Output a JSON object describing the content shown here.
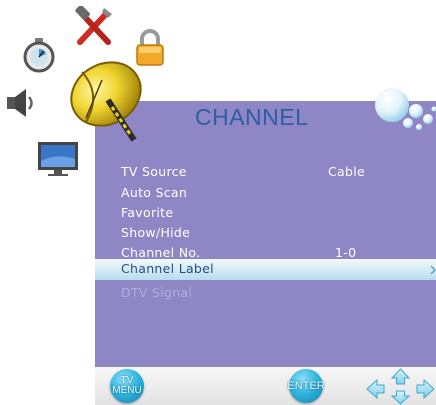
{
  "menu": {
    "title": "CHANNEL",
    "items": [
      {
        "label": "TV Source",
        "value": "Cable"
      },
      {
        "label": "Auto Scan",
        "value": ""
      },
      {
        "label": "Favorite",
        "value": ""
      },
      {
        "label": "Show/Hide",
        "value": ""
      },
      {
        "label": "Channel No.",
        "value": "1-0"
      },
      {
        "label": "Channel Label",
        "value": "",
        "selected": true
      },
      {
        "label": "DTV Signal",
        "value": "",
        "disabled": true
      }
    ]
  },
  "footer": {
    "tv_menu_line1": "TV",
    "tv_menu_line2": "MENU",
    "enter_label": "ENTER"
  },
  "side_icons": [
    "timer-icon",
    "tools-icon",
    "lock-icon",
    "speaker-icon",
    "satellite-dish-icon",
    "monitor-icon"
  ],
  "colors": {
    "panel": "#8f86c6",
    "title": "#2d5ea3",
    "highlight": "#cfe8f4",
    "button": "#31b6e0"
  }
}
